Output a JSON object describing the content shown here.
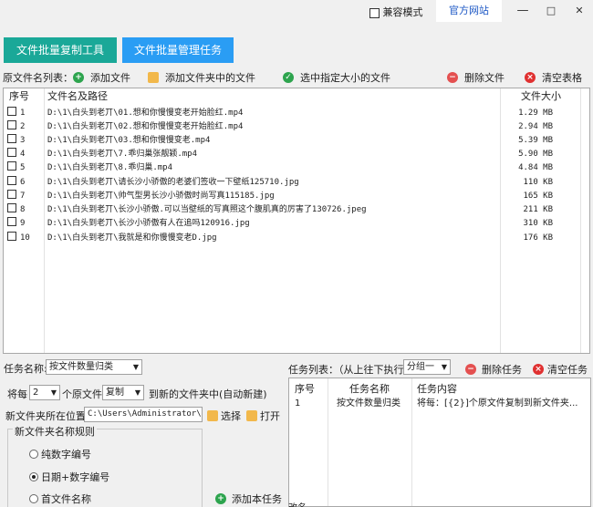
{
  "window": {
    "compat_mode_label": "兼容模式",
    "official_site_label": "官方网站",
    "minimize": "—",
    "maximize": "□",
    "close": "✕"
  },
  "top_buttons": {
    "copy_tool": "文件批量复制工具",
    "manage_tasks": "文件批量管理任务"
  },
  "colors": {
    "copy_tool_bg": "#1aa898",
    "manage_tasks_bg": "#2a9df4",
    "official_link": "#1a56c4",
    "add_icon": "#2da44e",
    "delete_icon": "#e45050",
    "clear_icon": "#e03030"
  },
  "toolbar": {
    "source_list_label": "原文件名列表：",
    "add_file": "添加文件",
    "add_folder_files": "添加文件夹中的文件",
    "select_by_size": "选中指定大小的文件",
    "delete_file": "删除文件",
    "clear_table": "清空表格"
  },
  "file_table": {
    "headers": {
      "index": "序号",
      "path": "文件名及路径",
      "size": "文件大小"
    },
    "rows": [
      {
        "idx": "1",
        "path": "D:\\1\\白头到老丌\\01.想和你慢慢变老开始脸红.mp4",
        "size": "1.29 MB"
      },
      {
        "idx": "2",
        "path": "D:\\1\\白头到老丌\\02.想和你慢慢变老开始脸红.mp4",
        "size": "2.94 MB"
      },
      {
        "idx": "3",
        "path": "D:\\1\\白头到老丌\\03.想和你慢慢变老.mp4",
        "size": "5.39 MB"
      },
      {
        "idx": "4",
        "path": "D:\\1\\白头到老丌\\7.乖归巢张靓颖.mp4",
        "size": "5.90 MB"
      },
      {
        "idx": "5",
        "path": "D:\\1\\白头到老丌\\8.乖归巢.mp4",
        "size": "4.84 MB"
      },
      {
        "idx": "6",
        "path": "D:\\1\\白头到老丌\\请长沙小骄傲的老婆们签收一下壁纸125710.jpg",
        "size": "110 KB"
      },
      {
        "idx": "7",
        "path": "D:\\1\\白头到老丌\\帅气型男长沙小骄傲时尚写真115185.jpg",
        "size": "165 KB"
      },
      {
        "idx": "8",
        "path": "D:\\1\\白头到老丌\\长沙小骄傲.可以当壁纸的写真照这个腹肌真的厉害了130726.jpeg",
        "size": "211 KB"
      },
      {
        "idx": "9",
        "path": "D:\\1\\白头到老丌\\长沙小骄傲有人在追吗120916.jpg",
        "size": "310 KB"
      },
      {
        "idx": "10",
        "path": "D:\\1\\白头到老丌\\我就是和你慢慢变老D.jpg",
        "size": "176 KB"
      }
    ]
  },
  "task_settings": {
    "task_name_label": "任务名称:",
    "task_name_value": "按文件数量归类",
    "every_label": "将每",
    "every_value": "2",
    "source_files_label": "个原文件",
    "mode_value": "复制",
    "to_new_folder_label": "到新的文件夹中(自动新建)",
    "new_folder_location_label": "新文件夹所在位置:",
    "new_folder_location_value": "C:\\Users\\Administrator\\Des",
    "choose_label": "选择",
    "open_label": "打开",
    "naming_rule_title": "新文件夹名称规则",
    "naming_options": [
      "纯数字编号",
      "日期+数字编号",
      "首文件名称"
    ],
    "naming_selected": "日期+数字编号",
    "add_task_label": "添加本任务"
  },
  "task_list": {
    "label": "任务列表：（从上往下执行）",
    "group_value": "分组一",
    "delete_task": "删除任务",
    "clear_tasks": "清空任务",
    "headers": {
      "index": "序号",
      "name": "任务名称",
      "content": "任务内容"
    },
    "rows": [
      {
        "idx": "1",
        "name": "按文件数量归类",
        "content": "将每：[{2}]个原文件复制到新文件夹..."
      }
    ],
    "bottom_fragment": "改名"
  }
}
